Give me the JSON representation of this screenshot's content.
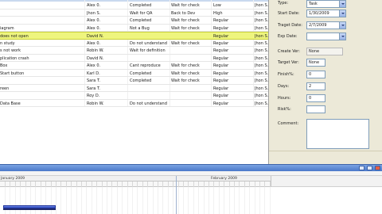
{
  "grid": {
    "rows": [
      {
        "title": "",
        "assigned": "Alex 0.",
        "status": "Completed",
        "state": "Wait for check",
        "priority": "Low",
        "owner": "Jhon S."
      },
      {
        "title": "",
        "assigned": "Jhon S.",
        "status": "Wait for QA",
        "state": "Back to Dev",
        "priority": "High",
        "owner": "Jhon S."
      },
      {
        "title": "",
        "assigned": "Alex 0.",
        "status": "Completed",
        "state": "Wait for check",
        "priority": "Regular",
        "owner": "Jhon S."
      },
      {
        "title": "iagram",
        "assigned": "Alex 0.",
        "status": "Not a Bug",
        "state": "Wait for check",
        "priority": "Regular",
        "owner": "Jhon S."
      },
      {
        "title": " does not open",
        "assigned": "David N.",
        "status": "",
        "state": "",
        "priority": "Regular",
        "owner": "Jhon S."
      },
      {
        "title": "n study",
        "assigned": "Alex 0.",
        "status": "Do not understand",
        "state": "Wait for check",
        "priority": "Regular",
        "owner": "Jhon S."
      },
      {
        "title": "s not work",
        "assigned": "Robin W.",
        "status": "Wait for definition",
        "state": "",
        "priority": "Regular",
        "owner": "Jhon S."
      },
      {
        "title": "plication crash",
        "assigned": "David N.",
        "status": "",
        "state": "",
        "priority": "Regular",
        "owner": "Jhon S."
      },
      {
        "title": " Box",
        "assigned": "Alex 0.",
        "status": "Cant reproduce",
        "state": "Wait for check",
        "priority": "Regular",
        "owner": "Jhon S."
      },
      {
        "title": "Start button",
        "assigned": "Karl D.",
        "status": "Completed",
        "state": "Wait for check",
        "priority": "Regular",
        "owner": "Jhon S."
      },
      {
        "title": "",
        "assigned": "Sara T.",
        "status": "Completed",
        "state": "Wait for check",
        "priority": "Regular",
        "owner": "Jhon S."
      },
      {
        "title": "reen",
        "assigned": "Sara T.",
        "status": "",
        "state": "",
        "priority": "Regular",
        "owner": "Jhon S."
      },
      {
        "title": "",
        "assigned": "Roy D.",
        "status": "",
        "state": "",
        "priority": "Regular",
        "owner": "Jhon S."
      },
      {
        "title": " Data Base",
        "assigned": "Robin W.",
        "status": "Do not understand",
        "state": "",
        "priority": "Regular",
        "owner": "Jhon S."
      }
    ]
  },
  "panel": {
    "type_label": "Type:",
    "type_value": "Task",
    "start_date_label": "Start Date:",
    "start_date_value": "1/30/2009",
    "target_date_label": "Traget Date:",
    "target_date_value": "2/7/2009",
    "exp_date_label": "Exp Date:",
    "exp_date_value": "",
    "create_ver_label": "Create Ver:",
    "create_ver_value": "None",
    "target_ver_label": "Target Ver:",
    "target_ver_value": "None",
    "finish_label": "Finish%:",
    "finish_value": "0",
    "days_label": "Days:",
    "days_value": "2",
    "hours_label": "Hours:",
    "hours_value": "0",
    "risk_label": "Risk%:",
    "risk_value": "",
    "comment_label": "Comment:"
  },
  "gantt": {
    "month1": "January 2009",
    "month2": "February 2009"
  },
  "colors": {
    "selected_row": "#eef57e",
    "panel_bg": "#ece9d8",
    "gantt_title": "#4b79c9",
    "gantt_bar": "#2f4fc2"
  }
}
